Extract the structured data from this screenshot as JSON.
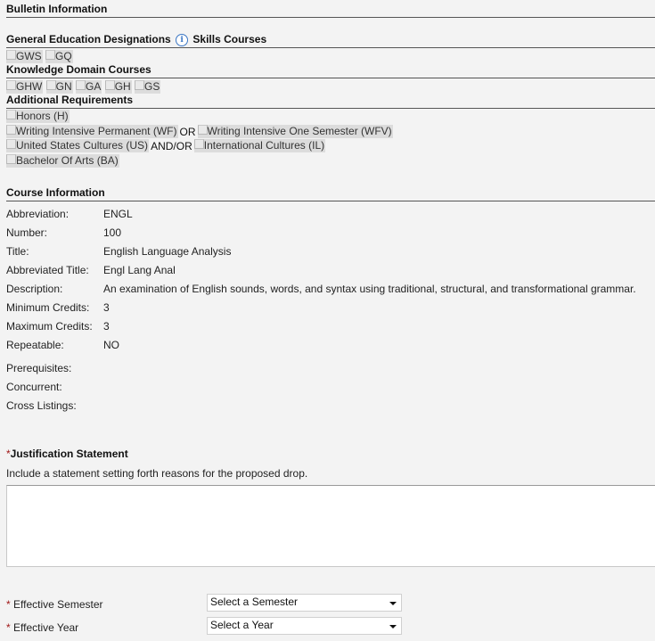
{
  "bulletin": {
    "title": "Bulletin Information",
    "gen_ed_title": "General Education Designations",
    "skills_title": "Skills Courses",
    "skills": [
      "GWS",
      "GQ"
    ],
    "knowledge_title": "Knowledge Domain Courses",
    "knowledge": [
      "GHW",
      "GN",
      "GA",
      "GH",
      "GS"
    ],
    "additional_title": "Additional Requirements",
    "honors": "Honors (H)",
    "wf": "Writing Intensive Permanent (WF)",
    "or": "OR",
    "wfv": "Writing Intensive One Semester (WFV)",
    "us": "United States Cultures (US)",
    "andor": "AND/OR",
    "il": "International Cultures (IL)",
    "ba": "Bachelor Of Arts (BA)"
  },
  "course": {
    "title": "Course Information",
    "rows": [
      {
        "label": "Abbreviation:",
        "value": "ENGL"
      },
      {
        "label": "Number:",
        "value": "100"
      },
      {
        "label": "Title:",
        "value": "English Language Analysis"
      },
      {
        "label": "Abbreviated Title:",
        "value": "Engl Lang Anal"
      },
      {
        "label": "Description:",
        "value": "An examination of English sounds, words, and syntax using traditional, structural, and transformational grammar."
      },
      {
        "label": "Minimum Credits:",
        "value": "3"
      },
      {
        "label": "Maximum Credits:",
        "value": "3"
      },
      {
        "label": "Repeatable:",
        "value": "NO"
      }
    ],
    "extra_rows": [
      {
        "label": "Prerequisites:",
        "value": ""
      },
      {
        "label": "Concurrent:",
        "value": ""
      },
      {
        "label": "Cross Listings:",
        "value": ""
      }
    ]
  },
  "justification": {
    "required_mark": "*",
    "title": "Justification Statement",
    "help": "Include a statement setting forth reasons for the proposed drop.",
    "value": ""
  },
  "effective": {
    "required_mark": "*",
    "semester_label": "Effective Semester",
    "semester_value": "Select a Semester",
    "year_label": "Effective Year",
    "year_value": "Select a Year"
  }
}
